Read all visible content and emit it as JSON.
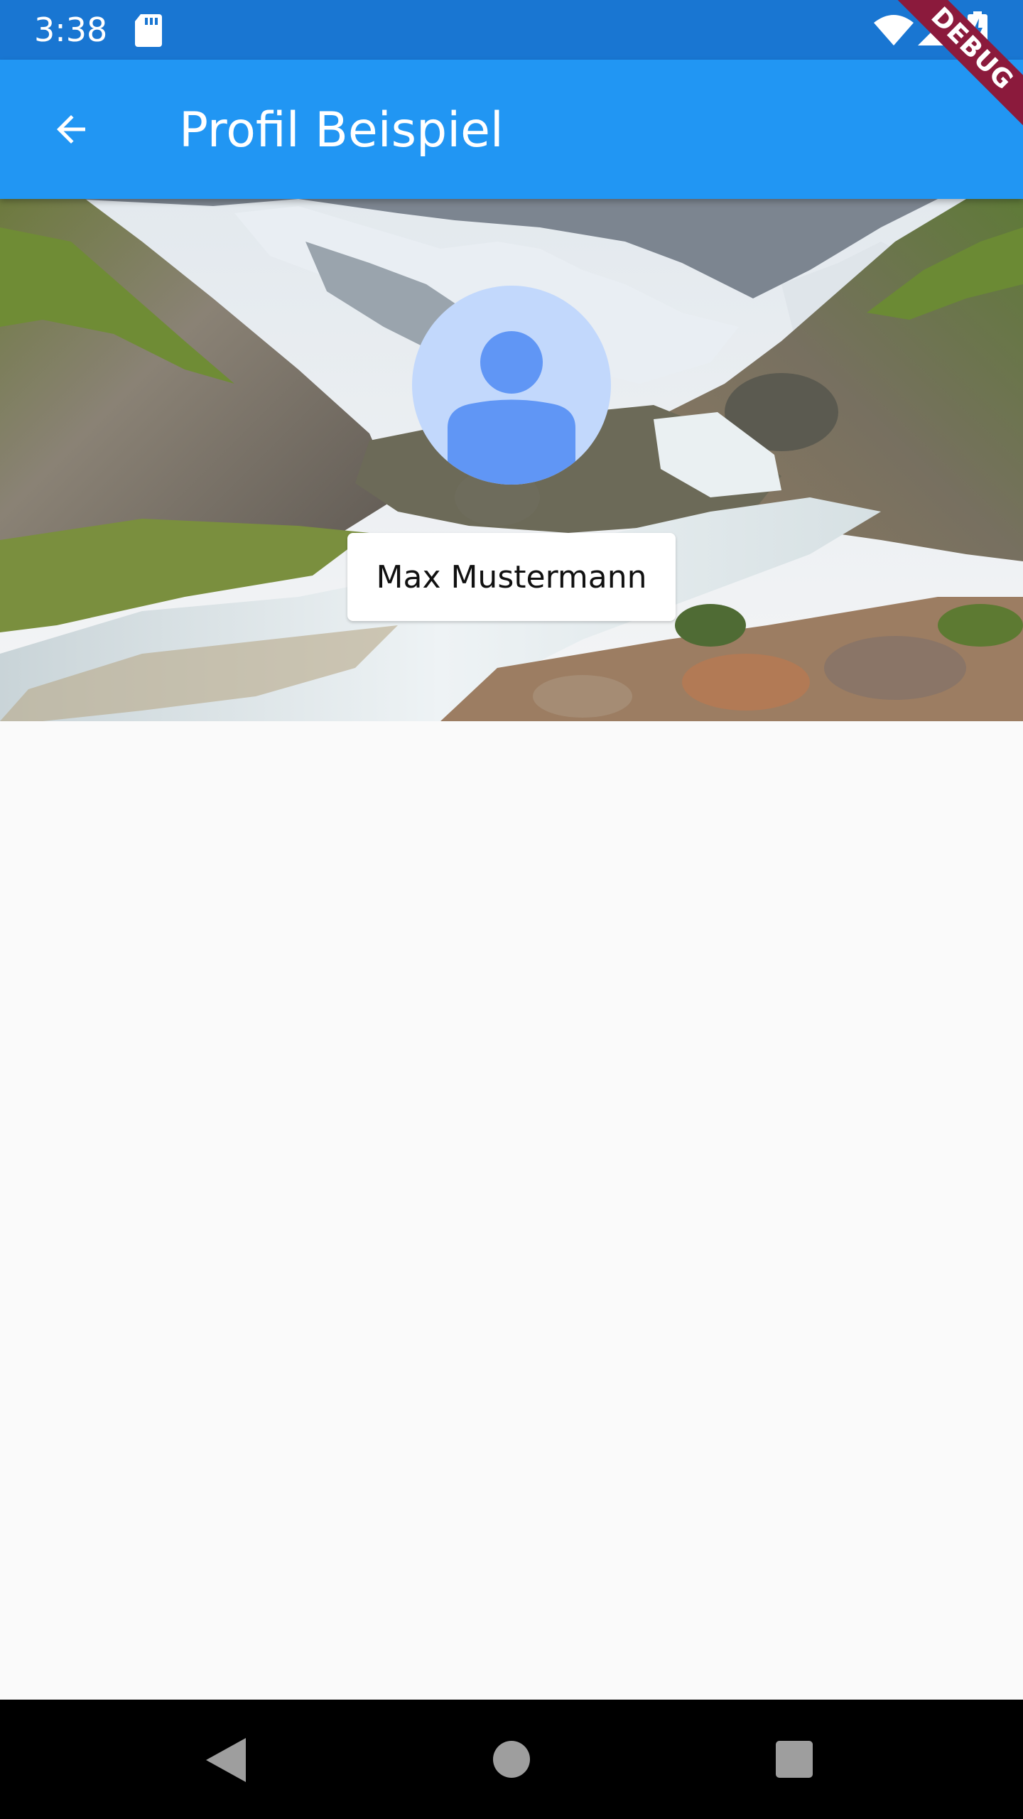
{
  "status_bar": {
    "time": "3:38",
    "icons": [
      "sd-card-icon",
      "wifi-icon",
      "signal-icon",
      "battery-charging-icon"
    ]
  },
  "app_bar": {
    "title": "Profil Beispiel",
    "back_icon": "arrow-back-icon"
  },
  "debug_banner": "DEBUG",
  "profile": {
    "name": "Max Mustermann",
    "avatar_icon": "person-icon"
  },
  "nav_bar": {
    "icons": [
      "nav-back-icon",
      "nav-home-icon",
      "nav-recents-icon"
    ]
  },
  "colors": {
    "status_bar": "#1976d2",
    "app_bar": "#2196f3",
    "avatar_bg": "#c2d8fc",
    "avatar_fg": "#6096f5",
    "debug_banner": "#8b1a3c"
  }
}
